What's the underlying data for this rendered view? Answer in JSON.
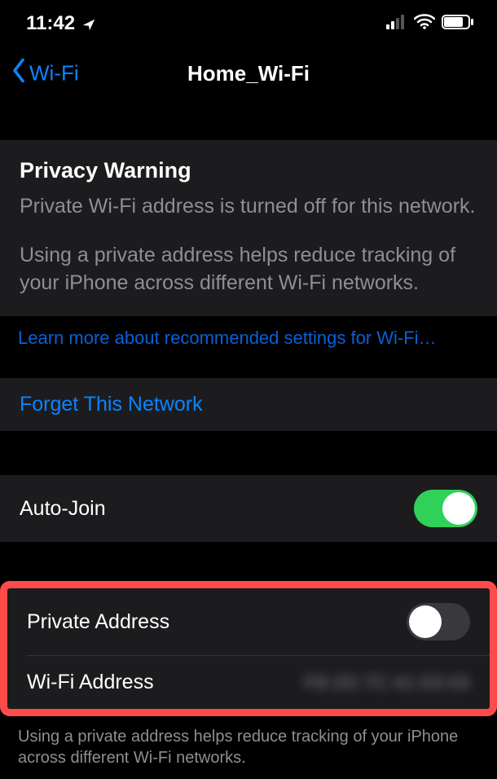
{
  "status_bar": {
    "time": "11:42"
  },
  "nav": {
    "back_label": "Wi-Fi",
    "title": "Home_Wi-Fi"
  },
  "privacy": {
    "heading": "Privacy Warning",
    "line1": "Private Wi-Fi address is turned off for this network.",
    "line2": "Using a private address helps reduce tracking of your iPhone across different Wi-Fi networks."
  },
  "learn_more": "Learn more about recommended settings for Wi-Fi…",
  "forget_label": "Forget This Network",
  "auto_join_label": "Auto-Join",
  "private_addr_label": "Private Address",
  "wifi_addr_label": "Wi-Fi Address",
  "wifi_addr_value": "F8:2D:7C:41:03:03",
  "footer_note": "Using a private address helps reduce tracking of your iPhone across different Wi-Fi networks."
}
